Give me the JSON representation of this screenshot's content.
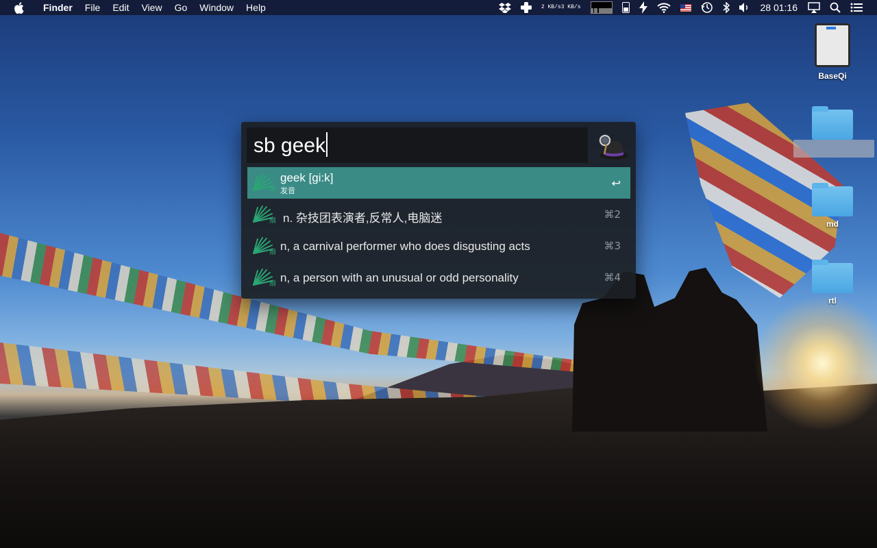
{
  "menubar": {
    "app_name": "Finder",
    "menus": [
      "File",
      "Edit",
      "View",
      "Go",
      "Window",
      "Help"
    ],
    "net_up": "2 KB/s",
    "net_down": "3 KB/s",
    "input_source": "US",
    "clock": "28 01:16"
  },
  "desktop": {
    "icons": [
      {
        "label": "BaseQi",
        "kind": "drive"
      },
      {
        "label": "",
        "kind": "folder"
      },
      {
        "label": "md",
        "kind": "folder"
      },
      {
        "label": "rtl",
        "kind": "folder"
      }
    ]
  },
  "alfred": {
    "query": "sb geek",
    "results": [
      {
        "title": "geek [gi:k]",
        "subtitle": "发音",
        "shortcut": "↩",
        "icon_glyph": "扇"
      },
      {
        "title": "n. 杂技团表演者,反常人,电脑迷",
        "subtitle": "",
        "shortcut": "⌘2",
        "icon_glyph": "扇"
      },
      {
        "title": "n, a carnival performer who does disgusting acts",
        "subtitle": "",
        "shortcut": "⌘3",
        "icon_glyph": "扇"
      },
      {
        "title": "n, a person with an unusual or odd personality",
        "subtitle": "",
        "shortcut": "⌘4",
        "icon_glyph": "扇"
      }
    ],
    "selected_color": "#3a8b86"
  }
}
